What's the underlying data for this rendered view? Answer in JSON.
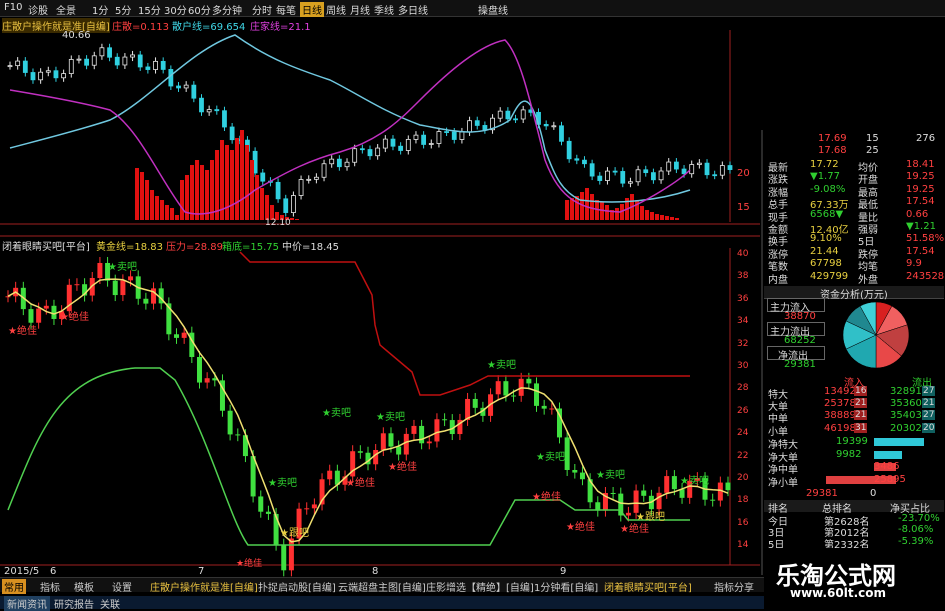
{
  "toolbar": {
    "items": [
      "F10",
      "诊股",
      "全景",
      "1分",
      "5分",
      "15分",
      "30分",
      "60分",
      "多分钟",
      "分时",
      "每笔",
      "日线",
      "周线",
      "月线",
      "季线",
      "多日线",
      "操盘线"
    ],
    "active": "日线"
  },
  "upper_panel": {
    "indicator_name": "庄散户操作就是准[自编]",
    "zhuang": "庄散=0.113",
    "sanhu": "散户线=69.654",
    "zhuangjia": "庄家线=21.1",
    "high_label": "40.66",
    "low_label": "12.10",
    "axis_labels": [
      "20",
      "15"
    ]
  },
  "lower_panel": {
    "indicator_name": "闭着眼睛买吧[平台]",
    "gold_line": "黄金线=18.83",
    "pressure": "压力=28.89",
    "support": "箱底=15.75",
    "mid": "中价=18.45",
    "axis_labels": [
      "40",
      "38",
      "36",
      "34",
      "32",
      "30",
      "28",
      "26",
      "24",
      "22",
      "20",
      "18",
      "16",
      "14"
    ],
    "date_labels": [
      "2015/5",
      "6",
      "7",
      "8",
      "9"
    ],
    "buy_label": "★卖吧",
    "hold_label": "★绝佳",
    "follow_label": "★跟吧"
  },
  "quote": {
    "top_vals": [
      "17.69",
      "15",
      "276",
      "17.68",
      "25"
    ],
    "rows": [
      {
        "l1": "最新",
        "v1": "17.72",
        "l2": "均价",
        "v2": "18.41"
      },
      {
        "l1": "涨跌",
        "v1": "▼1.77",
        "l2": "开盘",
        "v2": "19.25"
      },
      {
        "l1": "涨幅",
        "v1": "-9.08%",
        "l2": "最高",
        "v2": "19.25"
      },
      {
        "l1": "总手",
        "v1": "67.33万",
        "l2": "最低",
        "v2": "17.54"
      },
      {
        "l1": "现手",
        "v1": "6568▼",
        "l2": "量比",
        "v2": "0.66"
      },
      {
        "l1": "金额",
        "v1": "12.40亿",
        "l2": "强弱",
        "v2": "▼1.21"
      },
      {
        "l1": "换手",
        "v1": "9.10%",
        "l2": "5日",
        "v2": "51.58%"
      },
      {
        "l1": "涨停",
        "v1": "21.44",
        "l2": "跌停",
        "v2": "17.54"
      },
      {
        "l1": "笔数",
        "v1": "67798",
        "l2": "均笔",
        "v2": "9.9"
      },
      {
        "l1": "内盘",
        "v1": "429799",
        "l2": "外盘",
        "v2": "243528"
      }
    ],
    "fund_title": "资金分析(万元)",
    "main_in_label": "主力流入",
    "main_in": "38870",
    "main_out_label": "主力流出",
    "main_out": "68252",
    "net_out_label": "净流出",
    "net_out": "29381",
    "flow_header_in": "流入",
    "flow_header_out": "流出",
    "flows": [
      {
        "label": "特大",
        "in": "13492",
        "pin": "16",
        "out": "32891",
        "pout": "27"
      },
      {
        "label": "大单",
        "in": "25378",
        "pin": "21",
        "out": "35360",
        "pout": "21"
      },
      {
        "label": "中单",
        "in": "38889",
        "pin": "21",
        "out": "35403",
        "pout": "27"
      },
      {
        "label": "小单",
        "in": "46198",
        "pin": "31",
        "out": "20302",
        "pout": "20"
      }
    ],
    "nets": [
      {
        "label": "净特大",
        "val": "19399"
      },
      {
        "label": "净大单",
        "val": "9982"
      },
      {
        "label": "净中单",
        "val": "3486"
      },
      {
        "label": "净小单",
        "val": "25895"
      }
    ],
    "net_total": "29381",
    "net_zero": "0",
    "rank_header": [
      "排名",
      "总排名",
      "净买占比"
    ],
    "ranks": [
      {
        "d": "今日",
        "r": "第2628名",
        "p": "-23.70%"
      },
      {
        "d": "3日",
        "r": "第2012名",
        "p": "-8.06%"
      },
      {
        "d": "5日",
        "r": "第2332名",
        "p": "-5.39%"
      }
    ]
  },
  "bottom_tabs": [
    "常用",
    "指标",
    "模板",
    "设置",
    "庄散户操作就是准[自编]",
    "扑捉启动股[自编]",
    "云端超盘主图[自编]",
    "庄影增选【精绝】[自编]",
    "1分钟看[自编]",
    "闭着眼睛买吧[平台]",
    "指标分享"
  ],
  "status": [
    "新闻资讯",
    "研究报告",
    "关联"
  ],
  "watermark": {
    "title": "乐淘公式网",
    "url": "www.60lt.com"
  },
  "colors": {
    "up": "#ff3030",
    "down": "#30e0e0",
    "yellow": "#e8e060",
    "green": "#50d050",
    "darkred": "#b01010"
  }
}
